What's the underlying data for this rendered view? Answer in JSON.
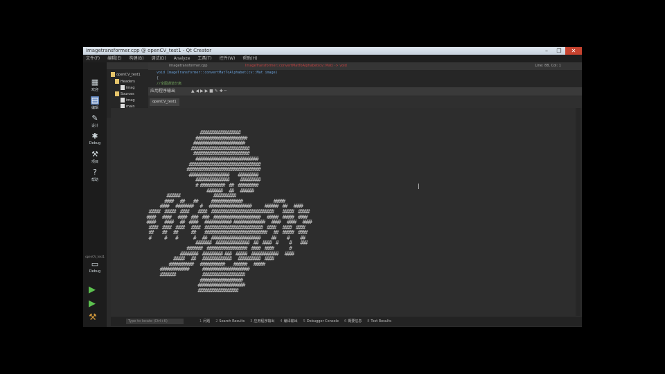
{
  "window": {
    "title": "imagetransformer.cpp @ openCV_test1 - Qt Creator",
    "controls": [
      "–",
      "❐",
      "✕"
    ]
  },
  "menu": [
    "文件(F)",
    "编辑(E)",
    "构建(B)",
    "调试(D)",
    "Analyze",
    "工具(T)",
    "控件(W)",
    "帮助(H)"
  ],
  "modes": [
    {
      "label": "欢迎",
      "icon": "grid-icon"
    },
    {
      "label": "编辑",
      "icon": "edit-icon"
    },
    {
      "label": "设计",
      "icon": "pencil-icon"
    },
    {
      "label": "Debug",
      "icon": "bug-icon"
    },
    {
      "label": "项目",
      "icon": "wrench-icon"
    },
    {
      "label": "帮助",
      "icon": "help-icon"
    }
  ],
  "kit": {
    "name": "openCV_test1",
    "config": "Debug"
  },
  "project_tree": [
    "openCV_test1",
    "Headers",
    "imag",
    "Sources",
    "imag",
    "main"
  ],
  "editor": {
    "file_tab": "imagetransformer.cpp",
    "function_crumb": "ImageTransformer::convertMatToAlphabet(cv::Mat) -> void",
    "line_info": "Line: 88, Col: 1",
    "code_line_1": "void ImageTransformer::convertMatToAlphabet(cv::Mat image)",
    "code_line_2": "{",
    "code_line_3": "    //全图通道分离"
  },
  "output_pane": {
    "title": "应用程序输出",
    "tab": "openCV_test1"
  },
  "ascii_art": "                         ##################\n                       #######################\n                      #######################\n                     ##########################\n                      #########################\n                       ############################\n                    ################################\n                   #################################\n                    ##################    #########\n                       ###############     #########\n                       # ###########  ##  #########\n                            #######   ##   ######\n          ######               ##########\n         ####   ##    ##      ##############              #####\n       ####   ########   #   ###################      ######  ##   ####\n  #####  #####  ####    ####  ############################    #####  #####\n ####   ####   ####  ###  ###  #####################   #####  #####  ####\n ####    ####   ##  ####   ############ ##############   ####   ####   ####\n  ####  ####  ####   ####  ##########################  ####   ####  ####\n  ##    ##   ##      ##    ############################   ##  #####  ####\n  #      #    #       #   ##  ######################     ##     #     ##\n                       #######  ###############  ##  ####  #     #    ###\n                   #######  ##################  ####  ####       #\n                ########  ######### ###  #####  ############   ####\n             #####   ##   #############   ##########  ####\n           ###########   ###########    ######   #####\n       #############      #####################\n       #######            ###################\n                         ###################\n                        #####################\n                        ##################",
  "bottom_bar": {
    "locator_placeholder": "Type to locate (Ctrl+K)",
    "tabs": [
      {
        "num": "1",
        "label": "问题"
      },
      {
        "num": "2",
        "label": "Search Results"
      },
      {
        "num": "3",
        "label": "应用程序输出"
      },
      {
        "num": "4",
        "label": "编译输出"
      },
      {
        "num": "5",
        "label": "Debugger Console"
      },
      {
        "num": "6",
        "label": "概要信息"
      },
      {
        "num": "8",
        "label": "Test Results"
      }
    ]
  }
}
